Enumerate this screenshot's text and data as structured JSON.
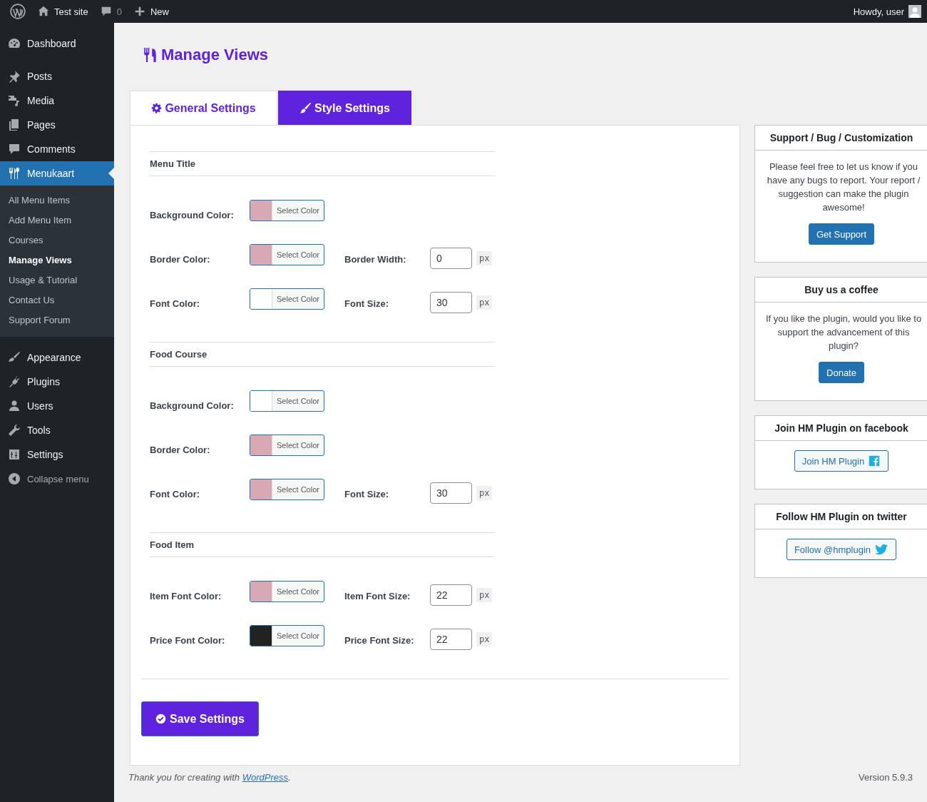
{
  "admin_bar": {
    "site": "Test site",
    "comments": "0",
    "new": "New",
    "greeting": "Howdy, user"
  },
  "sidebar": {
    "items": [
      {
        "label": "Dashboard",
        "selected": false
      },
      {
        "label": "Posts",
        "selected": false
      },
      {
        "label": "Media",
        "selected": false
      },
      {
        "label": "Pages",
        "selected": false
      },
      {
        "label": "Comments",
        "selected": false
      },
      {
        "label": "Menukaart",
        "selected": true,
        "children": [
          {
            "label": "All Menu Items",
            "selected": false
          },
          {
            "label": "Add Menu Item",
            "selected": false
          },
          {
            "label": "Courses",
            "selected": false
          },
          {
            "label": "Manage Views",
            "selected": true
          },
          {
            "label": "Usage & Tutorial",
            "selected": false
          },
          {
            "label": "Contact Us",
            "selected": false
          },
          {
            "label": "Support Forum",
            "selected": false
          }
        ]
      },
      {
        "label": "Appearance",
        "selected": false
      },
      {
        "label": "Plugins",
        "selected": false
      },
      {
        "label": "Users",
        "selected": false
      },
      {
        "label": "Tools",
        "selected": false
      },
      {
        "label": "Settings",
        "selected": false
      }
    ],
    "collapse": "Collapse menu"
  },
  "page": {
    "title": "Manage Views",
    "tabs": [
      {
        "label": "General Settings",
        "selected": false
      },
      {
        "label": "Style Settings",
        "selected": true
      }
    ],
    "sections": [
      {
        "title": "Menu Title",
        "rows": [
          {
            "fields": [
              {
                "kind": "color",
                "label": "Background Color:",
                "color": "#d8a9b2",
                "button": "Select Color"
              }
            ]
          },
          {
            "fields": [
              {
                "kind": "color",
                "label": "Border Color:",
                "color": "#d8a9b2",
                "button": "Select Color"
              },
              {
                "kind": "number",
                "label": "Border Width:",
                "value": "0",
                "unit": "px"
              }
            ]
          },
          {
            "fields": [
              {
                "kind": "color",
                "label": "Font Color:",
                "color": "#ffffff",
                "button": "Select Color"
              },
              {
                "kind": "number",
                "label": "Font Size:",
                "value": "30",
                "unit": "px"
              }
            ]
          }
        ]
      },
      {
        "title": "Food Course",
        "rows": [
          {
            "fields": [
              {
                "kind": "color",
                "label": "Background Color:",
                "color": "#ffffff",
                "button": "Select Color"
              }
            ]
          },
          {
            "fields": [
              {
                "kind": "color",
                "label": "Border Color:",
                "color": "#d8a9b2",
                "button": "Select Color"
              }
            ]
          },
          {
            "fields": [
              {
                "kind": "color",
                "label": "Font Color:",
                "color": "#d8a9b2",
                "button": "Select Color"
              },
              {
                "kind": "number",
                "label": "Font Size:",
                "value": "30",
                "unit": "px"
              }
            ]
          }
        ]
      },
      {
        "title": "Food Item",
        "rows": [
          {
            "fields": [
              {
                "kind": "color",
                "label": "Item Font Color:",
                "color": "#d8a9b2",
                "button": "Select Color"
              },
              {
                "kind": "number",
                "label": "Item Font Size:",
                "value": "22",
                "unit": "px"
              }
            ]
          },
          {
            "fields": [
              {
                "kind": "color",
                "label": "Price Font Color:",
                "color": "#222222",
                "button": "Select Color"
              },
              {
                "kind": "number",
                "label": "Price Font Size:",
                "value": "22",
                "unit": "px"
              }
            ]
          }
        ]
      }
    ],
    "save_button": "Save Settings"
  },
  "widgets": [
    {
      "title": "Support / Bug / Customization",
      "text": "Please feel free to let us know if you have any bugs to report. Your report / suggestion can make the plugin awesome!",
      "button": "Get Support",
      "kind": "primary"
    },
    {
      "title": "Buy us a coffee",
      "text": "If you like the plugin, would you like to support the advancement of this plugin?",
      "button": "Donate",
      "kind": "primary"
    },
    {
      "title": "Join HM Plugin on facebook",
      "button": "Join HM Plugin",
      "kind": "facebook"
    },
    {
      "title": "Follow HM Plugin on twitter",
      "button": "Follow @hmplugin",
      "kind": "twitter"
    }
  ],
  "footer": {
    "text": "Thank you for creating with ",
    "link": "WordPress",
    "after": ".",
    "version": "Version 5.9.3"
  }
}
